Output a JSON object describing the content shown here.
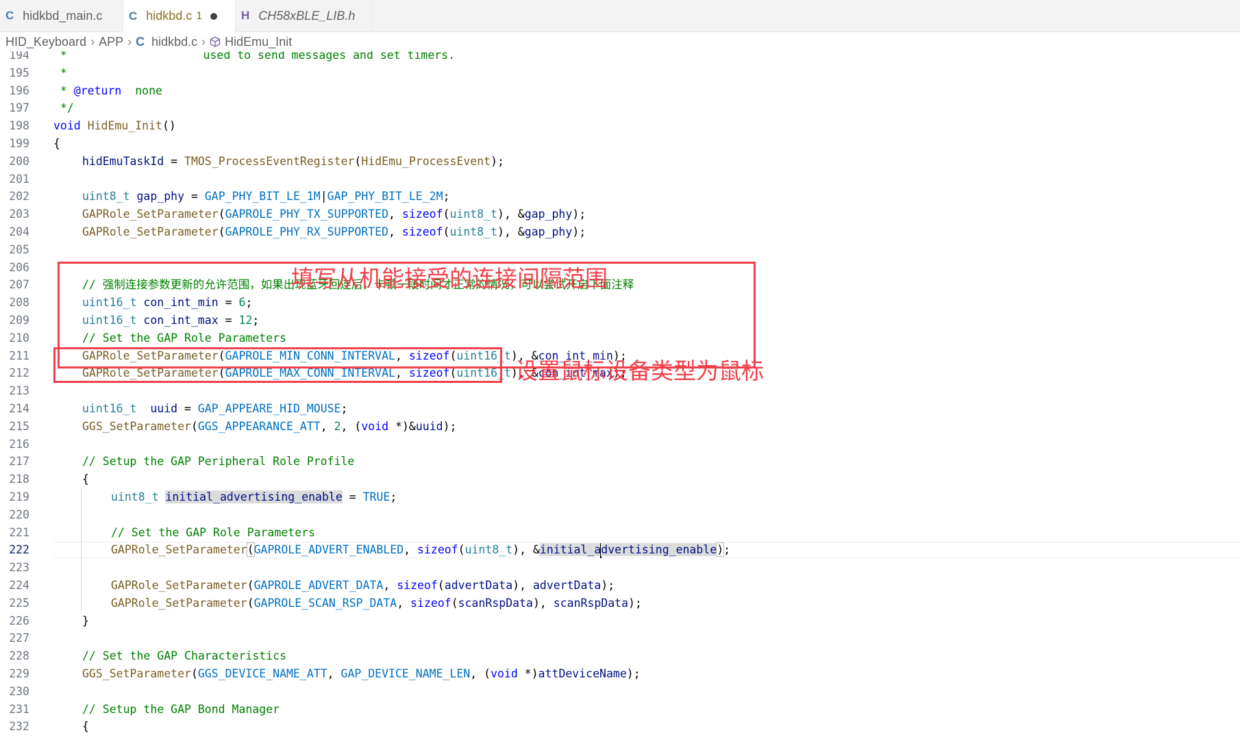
{
  "tabs": [
    {
      "icon": "C",
      "label": "hidkbd_main.c",
      "active": false,
      "modified": false,
      "preview": false,
      "badge": ""
    },
    {
      "icon": "C",
      "label": "hidkbd.c",
      "active": true,
      "modified": true,
      "preview": false,
      "badge": "1"
    },
    {
      "icon": "H",
      "label": "CH58xBLE_LIB.h",
      "active": false,
      "modified": false,
      "preview": true,
      "badge": ""
    }
  ],
  "breadcrumb": {
    "project": "HID_Keyboard",
    "folder": "APP",
    "file_icon": "C",
    "file": "hidkbd.c",
    "symbol": "HidEmu_Init"
  },
  "annotations": {
    "box1_text": "填写从机能接受的连接间隔范围",
    "box2_text": "设置鼠标设备类型为鼠标",
    "color": "#f2404b"
  },
  "editor": {
    "current_line": 222,
    "lines": [
      {
        "n": 194,
        "indent": 0,
        "tokens": [
          {
            "t": " *                    used to send messages and set timers.",
            "c": "cm"
          }
        ]
      },
      {
        "n": 195,
        "indent": 0,
        "tokens": [
          {
            "t": " *",
            "c": "cm"
          }
        ]
      },
      {
        "n": 196,
        "indent": 0,
        "tokens": [
          {
            "t": " * ",
            "c": "cm"
          },
          {
            "t": "@return",
            "c": "dk"
          },
          {
            "t": "  none",
            "c": "cm"
          }
        ]
      },
      {
        "n": 197,
        "indent": 0,
        "tokens": [
          {
            "t": " */",
            "c": "cm"
          }
        ]
      },
      {
        "n": 198,
        "indent": 0,
        "tokens": [
          {
            "t": "void",
            "c": "kw"
          },
          {
            "t": " ",
            "c": "pn"
          },
          {
            "t": "HidEmu_Init",
            "c": "fn"
          },
          {
            "t": "()",
            "c": "pn"
          }
        ]
      },
      {
        "n": 199,
        "indent": 0,
        "tokens": [
          {
            "t": "{",
            "c": "pn"
          }
        ]
      },
      {
        "n": 200,
        "indent": 1,
        "tokens": [
          {
            "t": "hidEmuTaskId",
            "c": "vr"
          },
          {
            "t": " = ",
            "c": "pn"
          },
          {
            "t": "TMOS_ProcessEventRegister",
            "c": "fn"
          },
          {
            "t": "(",
            "c": "pn"
          },
          {
            "t": "HidEmu_ProcessEvent",
            "c": "fn"
          },
          {
            "t": ");",
            "c": "pn"
          }
        ]
      },
      {
        "n": 201,
        "indent": 0,
        "tokens": []
      },
      {
        "n": 202,
        "indent": 1,
        "tokens": [
          {
            "t": "uint8_t",
            "c": "ty"
          },
          {
            "t": " ",
            "c": "pn"
          },
          {
            "t": "gap_phy",
            "c": "vr"
          },
          {
            "t": " = ",
            "c": "pn"
          },
          {
            "t": "GAP_PHY_BIT_LE_1M",
            "c": "mc"
          },
          {
            "t": "|",
            "c": "pn"
          },
          {
            "t": "GAP_PHY_BIT_LE_2M",
            "c": "mc"
          },
          {
            "t": ";",
            "c": "pn"
          }
        ]
      },
      {
        "n": 203,
        "indent": 1,
        "tokens": [
          {
            "t": "GAPRole_SetParameter",
            "c": "fn"
          },
          {
            "t": "(",
            "c": "pn"
          },
          {
            "t": "GAPROLE_PHY_TX_SUPPORTED",
            "c": "mc"
          },
          {
            "t": ", ",
            "c": "pn"
          },
          {
            "t": "sizeof",
            "c": "kw"
          },
          {
            "t": "(",
            "c": "pn"
          },
          {
            "t": "uint8_t",
            "c": "ty"
          },
          {
            "t": "), &",
            "c": "pn"
          },
          {
            "t": "gap_phy",
            "c": "vr"
          },
          {
            "t": ");",
            "c": "pn"
          }
        ]
      },
      {
        "n": 204,
        "indent": 1,
        "tokens": [
          {
            "t": "GAPRole_SetParameter",
            "c": "fn"
          },
          {
            "t": "(",
            "c": "pn"
          },
          {
            "t": "GAPROLE_PHY_RX_SUPPORTED",
            "c": "mc"
          },
          {
            "t": ", ",
            "c": "pn"
          },
          {
            "t": "sizeof",
            "c": "kw"
          },
          {
            "t": "(",
            "c": "pn"
          },
          {
            "t": "uint8_t",
            "c": "ty"
          },
          {
            "t": "), &",
            "c": "pn"
          },
          {
            "t": "gap_phy",
            "c": "vr"
          },
          {
            "t": ");",
            "c": "pn"
          }
        ]
      },
      {
        "n": 205,
        "indent": 0,
        "tokens": []
      },
      {
        "n": 206,
        "indent": 0,
        "tokens": []
      },
      {
        "n": 207,
        "indent": 1,
        "tokens": [
          {
            "t": "// 强制连接参数更新的允许范围，如果出现蓝牙回连后，卡顿一段时间才正常的情况，可以尝试开启下面注释",
            "c": "cm"
          }
        ]
      },
      {
        "n": 208,
        "indent": 1,
        "tokens": [
          {
            "t": "uint16_t",
            "c": "ty"
          },
          {
            "t": " ",
            "c": "pn"
          },
          {
            "t": "con_int_min",
            "c": "vr"
          },
          {
            "t": " = ",
            "c": "pn"
          },
          {
            "t": "6",
            "c": "nm"
          },
          {
            "t": ";",
            "c": "pn"
          }
        ]
      },
      {
        "n": 209,
        "indent": 1,
        "tokens": [
          {
            "t": "uint16_t",
            "c": "ty"
          },
          {
            "t": " ",
            "c": "pn"
          },
          {
            "t": "con_int_max",
            "c": "vr"
          },
          {
            "t": " = ",
            "c": "pn"
          },
          {
            "t": "12",
            "c": "nm"
          },
          {
            "t": ";",
            "c": "pn"
          }
        ]
      },
      {
        "n": 210,
        "indent": 1,
        "tokens": [
          {
            "t": "// Set the GAP Role Parameters",
            "c": "cm"
          }
        ]
      },
      {
        "n": 211,
        "indent": 1,
        "tokens": [
          {
            "t": "GAPRole_SetParameter",
            "c": "fn"
          },
          {
            "t": "(",
            "c": "pn"
          },
          {
            "t": "GAPROLE_MIN_CONN_INTERVAL",
            "c": "mc"
          },
          {
            "t": ", ",
            "c": "pn"
          },
          {
            "t": "sizeof",
            "c": "kw"
          },
          {
            "t": "(",
            "c": "pn"
          },
          {
            "t": "uint16_t",
            "c": "ty"
          },
          {
            "t": "), &",
            "c": "pn"
          },
          {
            "t": "con_int_min",
            "c": "vr"
          },
          {
            "t": ");",
            "c": "pn"
          }
        ]
      },
      {
        "n": 212,
        "indent": 1,
        "tokens": [
          {
            "t": "GAPRole_SetParameter",
            "c": "fn"
          },
          {
            "t": "(",
            "c": "pn"
          },
          {
            "t": "GAPROLE_MAX_CONN_INTERVAL",
            "c": "mc"
          },
          {
            "t": ", ",
            "c": "pn"
          },
          {
            "t": "sizeof",
            "c": "kw"
          },
          {
            "t": "(",
            "c": "pn"
          },
          {
            "t": "uint16_t",
            "c": "ty"
          },
          {
            "t": "), &",
            "c": "pn"
          },
          {
            "t": "con_int_max",
            "c": "vr"
          },
          {
            "t": ");",
            "c": "pn"
          }
        ]
      },
      {
        "n": 213,
        "indent": 0,
        "tokens": []
      },
      {
        "n": 214,
        "indent": 1,
        "tokens": [
          {
            "t": "uint16_t",
            "c": "ty"
          },
          {
            "t": "  ",
            "c": "pn"
          },
          {
            "t": "uuid",
            "c": "vr"
          },
          {
            "t": " = ",
            "c": "pn"
          },
          {
            "t": "GAP_APPEARE_HID_MOUSE",
            "c": "mc"
          },
          {
            "t": ";",
            "c": "pn"
          }
        ]
      },
      {
        "n": 215,
        "indent": 1,
        "tokens": [
          {
            "t": "GGS_SetParameter",
            "c": "fn"
          },
          {
            "t": "(",
            "c": "pn"
          },
          {
            "t": "GGS_APPEARANCE_ATT",
            "c": "mc"
          },
          {
            "t": ", ",
            "c": "pn"
          },
          {
            "t": "2",
            "c": "nm"
          },
          {
            "t": ", (",
            "c": "pn"
          },
          {
            "t": "void",
            "c": "kw"
          },
          {
            "t": " *)&",
            "c": "pn"
          },
          {
            "t": "uuid",
            "c": "vr"
          },
          {
            "t": ");",
            "c": "pn"
          }
        ]
      },
      {
        "n": 216,
        "indent": 0,
        "tokens": []
      },
      {
        "n": 217,
        "indent": 1,
        "tokens": [
          {
            "t": "// Setup the GAP Peripheral Role Profile",
            "c": "cm"
          }
        ]
      },
      {
        "n": 218,
        "indent": 1,
        "tokens": [
          {
            "t": "{",
            "c": "pn"
          }
        ]
      },
      {
        "n": 219,
        "indent": 2,
        "tokens": [
          {
            "t": "uint8_t",
            "c": "ty"
          },
          {
            "t": " ",
            "c": "pn"
          },
          {
            "t": "initial_advertising_enable",
            "c": "vr",
            "hl": "hl"
          },
          {
            "t": " = ",
            "c": "pn"
          },
          {
            "t": "TRUE",
            "c": "mc"
          },
          {
            "t": ";",
            "c": "pn"
          }
        ]
      },
      {
        "n": 220,
        "indent": 0,
        "tokens": []
      },
      {
        "n": 221,
        "indent": 2,
        "tokens": [
          {
            "t": "// Set the GAP Role Parameters",
            "c": "cm"
          }
        ]
      },
      {
        "n": 222,
        "indent": 2,
        "tokens": [
          {
            "t": "GAPRole_SetParameter",
            "c": "fn"
          },
          {
            "t": "(",
            "c": "pn",
            "box": true
          },
          {
            "t": "GAPROLE_ADVERT_ENABLED",
            "c": "mc"
          },
          {
            "t": ", ",
            "c": "pn"
          },
          {
            "t": "sizeof",
            "c": "kw"
          },
          {
            "t": "(",
            "c": "pn"
          },
          {
            "t": "uint8_t",
            "c": "ty"
          },
          {
            "t": "), &",
            "c": "pn"
          },
          {
            "t": "initial_a",
            "c": "vr",
            "hl": "hlw"
          },
          {
            "t": "|",
            "c": "caret"
          },
          {
            "t": "dvertising_enable",
            "c": "vr",
            "hl": "hlw"
          },
          {
            "t": ")",
            "c": "pn",
            "box": true
          },
          {
            "t": ";",
            "c": "pn"
          }
        ]
      },
      {
        "n": 223,
        "indent": 0,
        "tokens": []
      },
      {
        "n": 224,
        "indent": 2,
        "tokens": [
          {
            "t": "GAPRole_SetParameter",
            "c": "fn"
          },
          {
            "t": "(",
            "c": "pn"
          },
          {
            "t": "GAPROLE_ADVERT_DATA",
            "c": "mc"
          },
          {
            "t": ", ",
            "c": "pn"
          },
          {
            "t": "sizeof",
            "c": "kw"
          },
          {
            "t": "(",
            "c": "pn"
          },
          {
            "t": "advertData",
            "c": "vr"
          },
          {
            "t": "), ",
            "c": "pn"
          },
          {
            "t": "advertData",
            "c": "vr"
          },
          {
            "t": ");",
            "c": "pn"
          }
        ]
      },
      {
        "n": 225,
        "indent": 2,
        "tokens": [
          {
            "t": "GAPRole_SetParameter",
            "c": "fn"
          },
          {
            "t": "(",
            "c": "pn"
          },
          {
            "t": "GAPROLE_SCAN_RSP_DATA",
            "c": "mc"
          },
          {
            "t": ", ",
            "c": "pn"
          },
          {
            "t": "sizeof",
            "c": "kw"
          },
          {
            "t": "(",
            "c": "pn"
          },
          {
            "t": "scanRspData",
            "c": "vr"
          },
          {
            "t": "), ",
            "c": "pn"
          },
          {
            "t": "scanRspData",
            "c": "vr"
          },
          {
            "t": ");",
            "c": "pn"
          }
        ]
      },
      {
        "n": 226,
        "indent": 1,
        "tokens": [
          {
            "t": "}",
            "c": "pn"
          }
        ]
      },
      {
        "n": 227,
        "indent": 0,
        "tokens": []
      },
      {
        "n": 228,
        "indent": 1,
        "tokens": [
          {
            "t": "// Set the GAP Characteristics",
            "c": "cm"
          }
        ]
      },
      {
        "n": 229,
        "indent": 1,
        "tokens": [
          {
            "t": "GGS_SetParameter",
            "c": "fn"
          },
          {
            "t": "(",
            "c": "pn"
          },
          {
            "t": "GGS_DEVICE_NAME_ATT",
            "c": "mc"
          },
          {
            "t": ", ",
            "c": "pn"
          },
          {
            "t": "GAP_DEVICE_NAME_LEN",
            "c": "mc"
          },
          {
            "t": ", (",
            "c": "pn"
          },
          {
            "t": "void",
            "c": "kw"
          },
          {
            "t": " *)",
            "c": "pn"
          },
          {
            "t": "attDeviceName",
            "c": "vr"
          },
          {
            "t": ");",
            "c": "pn"
          }
        ]
      },
      {
        "n": 230,
        "indent": 0,
        "tokens": []
      },
      {
        "n": 231,
        "indent": 1,
        "tokens": [
          {
            "t": "// Setup the GAP Bond Manager",
            "c": "cm"
          }
        ]
      },
      {
        "n": 232,
        "indent": 1,
        "tokens": [
          {
            "t": "{",
            "c": "pn"
          }
        ]
      }
    ]
  }
}
